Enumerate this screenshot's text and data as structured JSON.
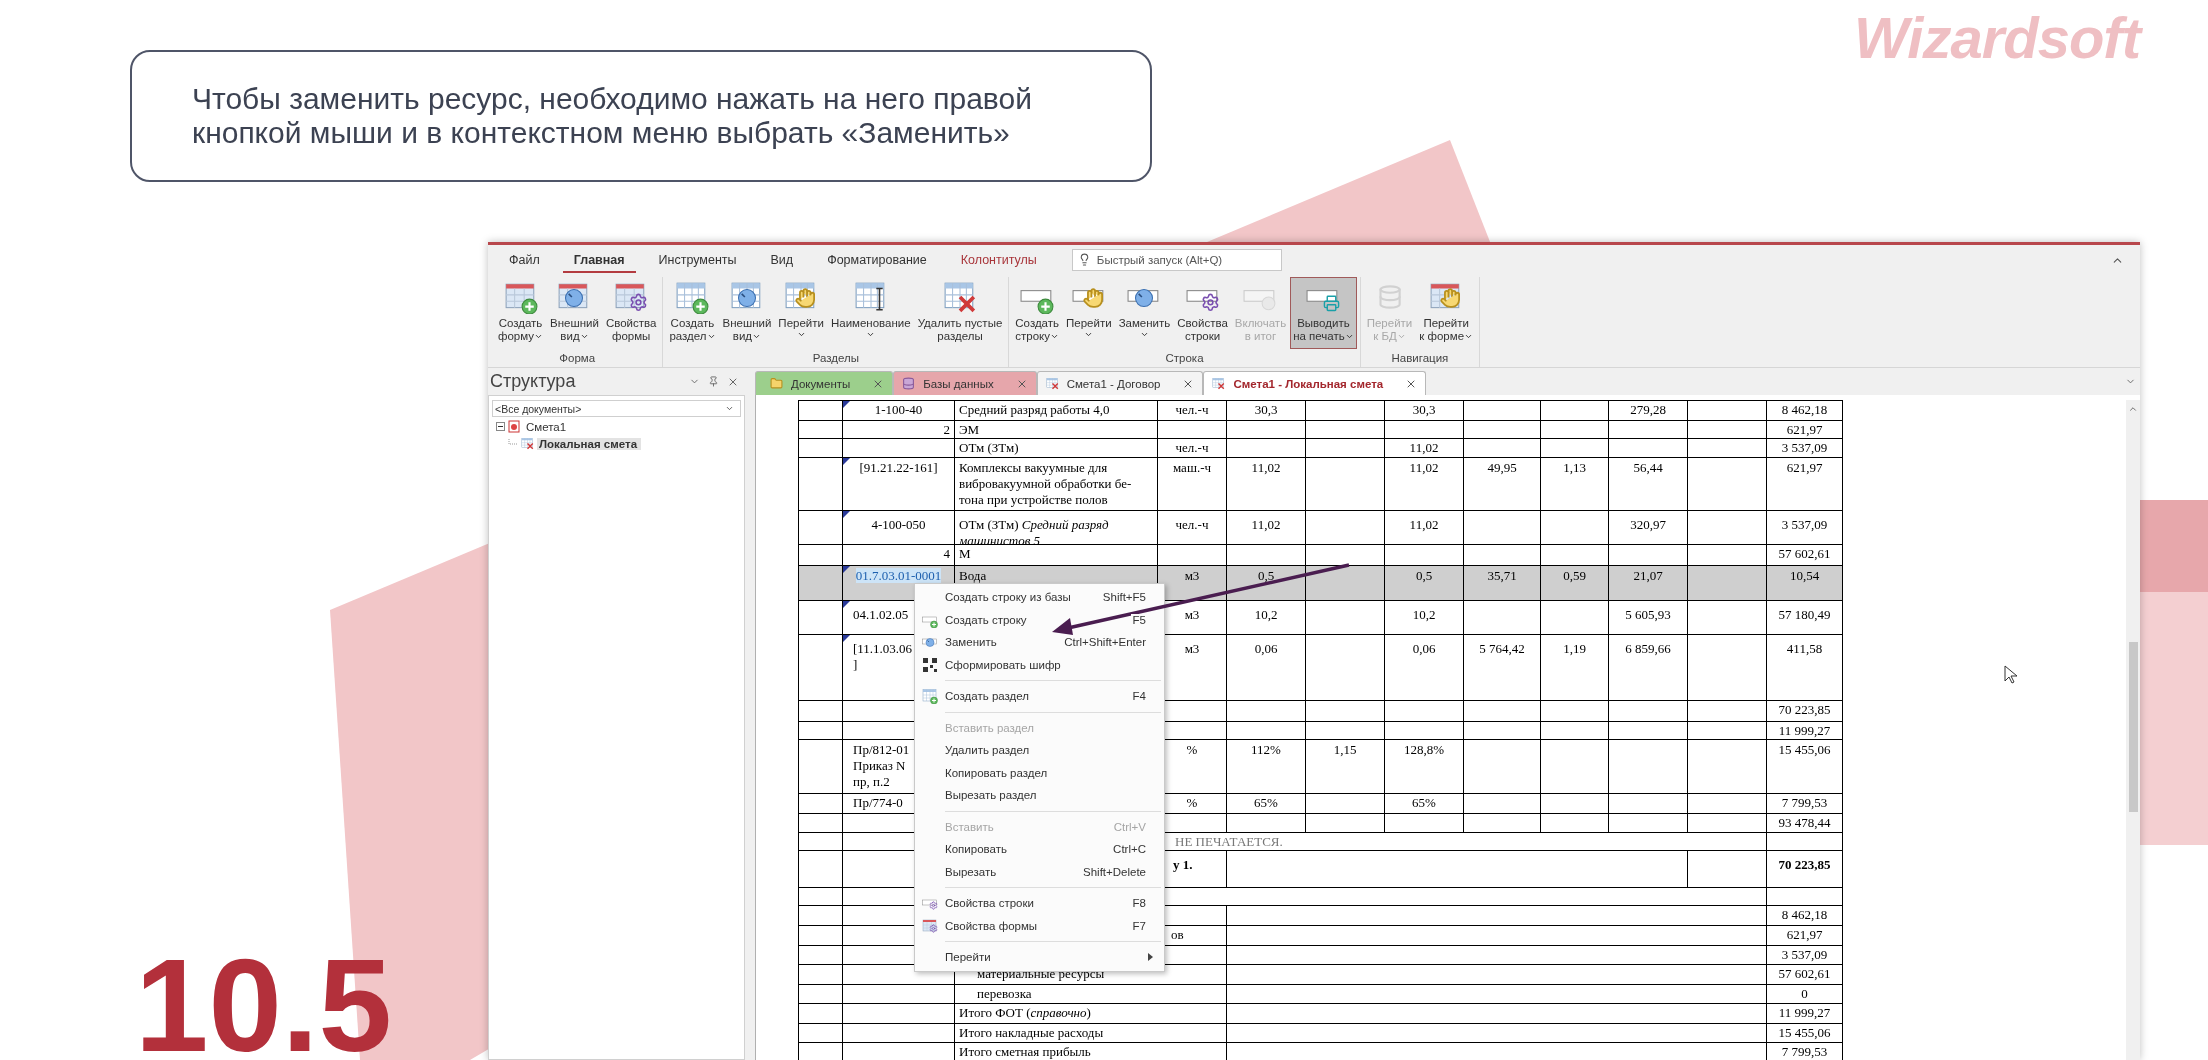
{
  "slide": {
    "logo": "Wizardsoft",
    "instruction": "Чтобы заменить ресурс, необходимо нажать на него правой кнопкой мыши и в контекстном меню выбрать «Заменить»",
    "section_number": "10.5"
  },
  "ribbon": {
    "tabs": [
      {
        "label": "Файл",
        "selected": false,
        "contextual": false
      },
      {
        "label": "Главная",
        "selected": true,
        "contextual": false
      },
      {
        "label": "Инструменты",
        "selected": false,
        "contextual": false
      },
      {
        "label": "Вид",
        "selected": false,
        "contextual": false
      },
      {
        "label": "Форматирование",
        "selected": false,
        "contextual": false
      },
      {
        "label": "Колонтитулы",
        "selected": false,
        "contextual": true
      }
    ],
    "quick_launch": {
      "placeholder": "Быстрый запуск (Alt+Q)"
    },
    "groups": [
      {
        "label": "Форма",
        "buttons": [
          {
            "lines": [
              "Создать",
              "форму"
            ],
            "dropdown": true,
            "disabled": false,
            "pressed": false
          },
          {
            "lines": [
              "Внешний",
              "вид"
            ],
            "dropdown": true,
            "disabled": false,
            "pressed": false
          },
          {
            "lines": [
              "Свойства",
              "формы"
            ],
            "dropdown": false,
            "disabled": false,
            "pressed": false
          }
        ]
      },
      {
        "label": "Разделы",
        "buttons": [
          {
            "lines": [
              "Создать",
              "раздел"
            ],
            "dropdown": true,
            "disabled": false,
            "pressed": false
          },
          {
            "lines": [
              "Внешний",
              "вид"
            ],
            "dropdown": true,
            "disabled": false,
            "pressed": false
          },
          {
            "lines": [
              "Перейти"
            ],
            "dropdown": true,
            "disabled": false,
            "pressed": false
          },
          {
            "lines": [
              "Наименование"
            ],
            "dropdown": true,
            "disabled": false,
            "pressed": false
          },
          {
            "lines": [
              "Удалить пустые",
              "разделы"
            ],
            "dropdown": false,
            "disabled": false,
            "pressed": false
          }
        ]
      },
      {
        "label": "Строка",
        "buttons": [
          {
            "lines": [
              "Создать",
              "строку"
            ],
            "dropdown": true,
            "disabled": false,
            "pressed": false
          },
          {
            "lines": [
              "Перейти"
            ],
            "dropdown": true,
            "disabled": false,
            "pressed": false
          },
          {
            "lines": [
              "Заменить"
            ],
            "dropdown": true,
            "disabled": false,
            "pressed": false
          },
          {
            "lines": [
              "Свойства",
              "строки"
            ],
            "dropdown": false,
            "disabled": false,
            "pressed": false
          },
          {
            "lines": [
              "Включать",
              "в итог"
            ],
            "dropdown": false,
            "disabled": true,
            "pressed": false
          },
          {
            "lines": [
              "Выводить",
              "на печать"
            ],
            "dropdown": true,
            "disabled": false,
            "pressed": true
          }
        ]
      },
      {
        "label": "Навигация",
        "buttons": [
          {
            "lines": [
              "Перейти",
              "к БД"
            ],
            "dropdown": true,
            "disabled": true,
            "pressed": false
          },
          {
            "lines": [
              "Перейти",
              "к форме"
            ],
            "dropdown": true,
            "disabled": false,
            "pressed": false
          }
        ]
      }
    ]
  },
  "structure_panel": {
    "title": "Структура",
    "filter": "<Все документы>",
    "tree": [
      {
        "label": "Смета1",
        "expanded": true,
        "selected": false,
        "children": [
          {
            "label": "Локальная смета",
            "selected": true
          }
        ]
      }
    ]
  },
  "document_tabs": [
    {
      "label": "Документы",
      "color": "#9ccf8c",
      "selected": false
    },
    {
      "label": "Базы данных",
      "color": "#e6a6ab",
      "selected": false
    },
    {
      "label": "Смета1 - Договор",
      "color": "#f4f4f4",
      "selected": false
    },
    {
      "label": "Смета1 - Локальная смета",
      "color": "#ffffff",
      "selected": true
    }
  ],
  "table": {
    "rows": [
      {
        "kind": "grid",
        "flagged": true,
        "selected": false,
        "column_2": "1-100-40",
        "column_3": "Средний разряд работы 4,0",
        "column_4": "чел.-ч",
        "column_5": "30,3",
        "column_7": "30,3",
        "column_10": "279,28",
        "column_12": "8 462,18"
      },
      {
        "kind": "section",
        "flagged": false,
        "selected": false,
        "column_2": "2",
        "column_3": "ЭМ",
        "column_12": "621,97"
      },
      {
        "kind": "grid",
        "flagged": false,
        "selected": false,
        "column_3": "ОТм (ЗТм)",
        "column_4": "чел.-ч",
        "column_7": "11,02",
        "column_12": "3 537,09"
      },
      {
        "kind": "grid",
        "flagged": true,
        "selected": false,
        "column_2": "[91.21.22-161]",
        "column_3": "Комплексы вакуумные для\nвибровакуумной обработки бе-\nтона при устройстве полов",
        "column_4": "маш.-ч",
        "column_5": "11,02",
        "column_7": "11,02",
        "column_8": "49,95",
        "column_9": "1,13",
        "column_10": "56,44",
        "column_12": "621,97"
      },
      {
        "kind": "grid",
        "flagged": true,
        "selected": false,
        "column_2": "4-100-050",
        "column_3": "ОТм (ЗТм) *Средний разряд*\n*машинистов 5*",
        "column_4": "чел.-ч",
        "column_5": "11,02",
        "column_7": "11,02",
        "column_10": "320,97",
        "column_12": "3 537,09"
      },
      {
        "kind": "section",
        "flagged": false,
        "selected": false,
        "column_2": "4",
        "column_3": "М",
        "column_12": "57 602,61"
      },
      {
        "kind": "grid",
        "flagged": true,
        "selected": true,
        "text_selected": true,
        "column_2": "01.7.03.01-0001",
        "column_3": "Вода",
        "column_4": "м3",
        "column_5": "0,5",
        "column_7": "0,5",
        "column_8": "35,71",
        "column_9": "0,59",
        "column_10": "21,07",
        "column_12": "10,54"
      },
      {
        "kind": "grid",
        "flagged": true,
        "selected": false,
        "partly_covered": true,
        "column_2": "04.1.02.05",
        "column_4": "м3",
        "column_5": "10,2",
        "column_7": "10,2",
        "column_10": "5 605,93",
        "column_12": "57 180,49"
      },
      {
        "kind": "grid",
        "flagged": true,
        "selected": false,
        "partly_covered": true,
        "column_2": "[11.1.03.06\n]",
        "column_4": "м3",
        "column_5": "0,06",
        "column_7": "0,06",
        "column_8": "5 764,42",
        "column_9": "1,19",
        "column_10": "6 859,66",
        "column_12": "411,58"
      },
      {
        "kind": "grid",
        "flagged": false,
        "selected": false,
        "column_12": "70 223,85"
      },
      {
        "kind": "grid",
        "flagged": false,
        "selected": false,
        "column_12": "11 999,27"
      },
      {
        "kind": "grid",
        "flagged": false,
        "selected": false,
        "partly_covered": true,
        "column_2": "Пр/812-01\nПриказ N\nпр, п.2",
        "column_4": "%",
        "column_5": "112%",
        "column_6": "1,15",
        "column_7": "128,8%",
        "column_12": "15 455,06"
      },
      {
        "kind": "grid",
        "flagged": false,
        "selected": false,
        "partly_covered": true,
        "column_2": "Пр/774-0",
        "column_4": "%",
        "column_5": "65%",
        "column_7": "65%",
        "column_12": "7 799,53"
      },
      {
        "kind": "grid",
        "flagged": false,
        "selected": false,
        "column_12": "93 478,44"
      },
      {
        "kind": "note",
        "partly_covered": true,
        "text": "НЕ ПЕЧАТАЕТСЯ."
      },
      {
        "kind": "subtotal",
        "partly_covered": true,
        "label": "у 1.",
        "total": "70 223,85"
      },
      {
        "kind": "note"
      },
      {
        "kind": "summary",
        "total": "8 462,18"
      },
      {
        "kind": "summary",
        "partly_covered": true,
        "indented": false,
        "label": "ов",
        "total": "621,97"
      },
      {
        "kind": "summary",
        "total": "3 537,09"
      },
      {
        "kind": "summary",
        "indented": true,
        "label": "материальные ресурсы",
        "total": "57 602,61"
      },
      {
        "kind": "summary",
        "indented": true,
        "label": "перевозка",
        "total": "0"
      },
      {
        "kind": "summary",
        "indented": false,
        "label": "Итого ФОТ (*справочно*)",
        "total": "11 999,27"
      },
      {
        "kind": "summary",
        "indented": false,
        "label": "Итого накладные расходы",
        "total": "15 455,06"
      },
      {
        "kind": "summary",
        "indented": false,
        "label": "Итого сметная прибыль",
        "total": "7 799,53"
      }
    ]
  },
  "context_menu": {
    "items": [
      {
        "kind": "item",
        "label": "Создать строку из базы",
        "shortcut": "Shift+F5",
        "disabled": false,
        "submenu": false
      },
      {
        "kind": "item",
        "label": "Создать строку",
        "shortcut": "F5",
        "disabled": false,
        "submenu": false
      },
      {
        "kind": "item",
        "label": "Заменить",
        "shortcut": "Ctrl+Shift+Enter",
        "disabled": false,
        "submenu": false
      },
      {
        "kind": "item",
        "label": "Сформировать шифр",
        "disabled": false,
        "submenu": false
      },
      {
        "kind": "separator"
      },
      {
        "kind": "item",
        "label": "Создать раздел",
        "shortcut": "F4",
        "disabled": false,
        "submenu": false
      },
      {
        "kind": "separator"
      },
      {
        "kind": "item",
        "label": "Вставить раздел",
        "disabled": true,
        "submenu": false
      },
      {
        "kind": "item",
        "label": "Удалить раздел",
        "disabled": false,
        "submenu": false
      },
      {
        "kind": "item",
        "label": "Копировать раздел",
        "disabled": false,
        "submenu": false
      },
      {
        "kind": "item",
        "label": "Вырезать раздел",
        "disabled": false,
        "submenu": false
      },
      {
        "kind": "separator"
      },
      {
        "kind": "item",
        "label": "Вставить",
        "shortcut": "Ctrl+V",
        "disabled": true,
        "submenu": false
      },
      {
        "kind": "item",
        "label": "Копировать",
        "shortcut": "Ctrl+C",
        "disabled": false,
        "submenu": false
      },
      {
        "kind": "item",
        "label": "Вырезать",
        "shortcut": "Shift+Delete",
        "disabled": false,
        "submenu": false
      },
      {
        "kind": "separator"
      },
      {
        "kind": "item",
        "label": "Свойства строки",
        "shortcut": "F8",
        "disabled": false,
        "submenu": false
      },
      {
        "kind": "item",
        "label": "Свойства формы",
        "shortcut": "F7",
        "disabled": false,
        "submenu": false
      },
      {
        "kind": "separator"
      },
      {
        "kind": "item",
        "label": "Перейти",
        "disabled": false,
        "submenu": true
      }
    ]
  }
}
